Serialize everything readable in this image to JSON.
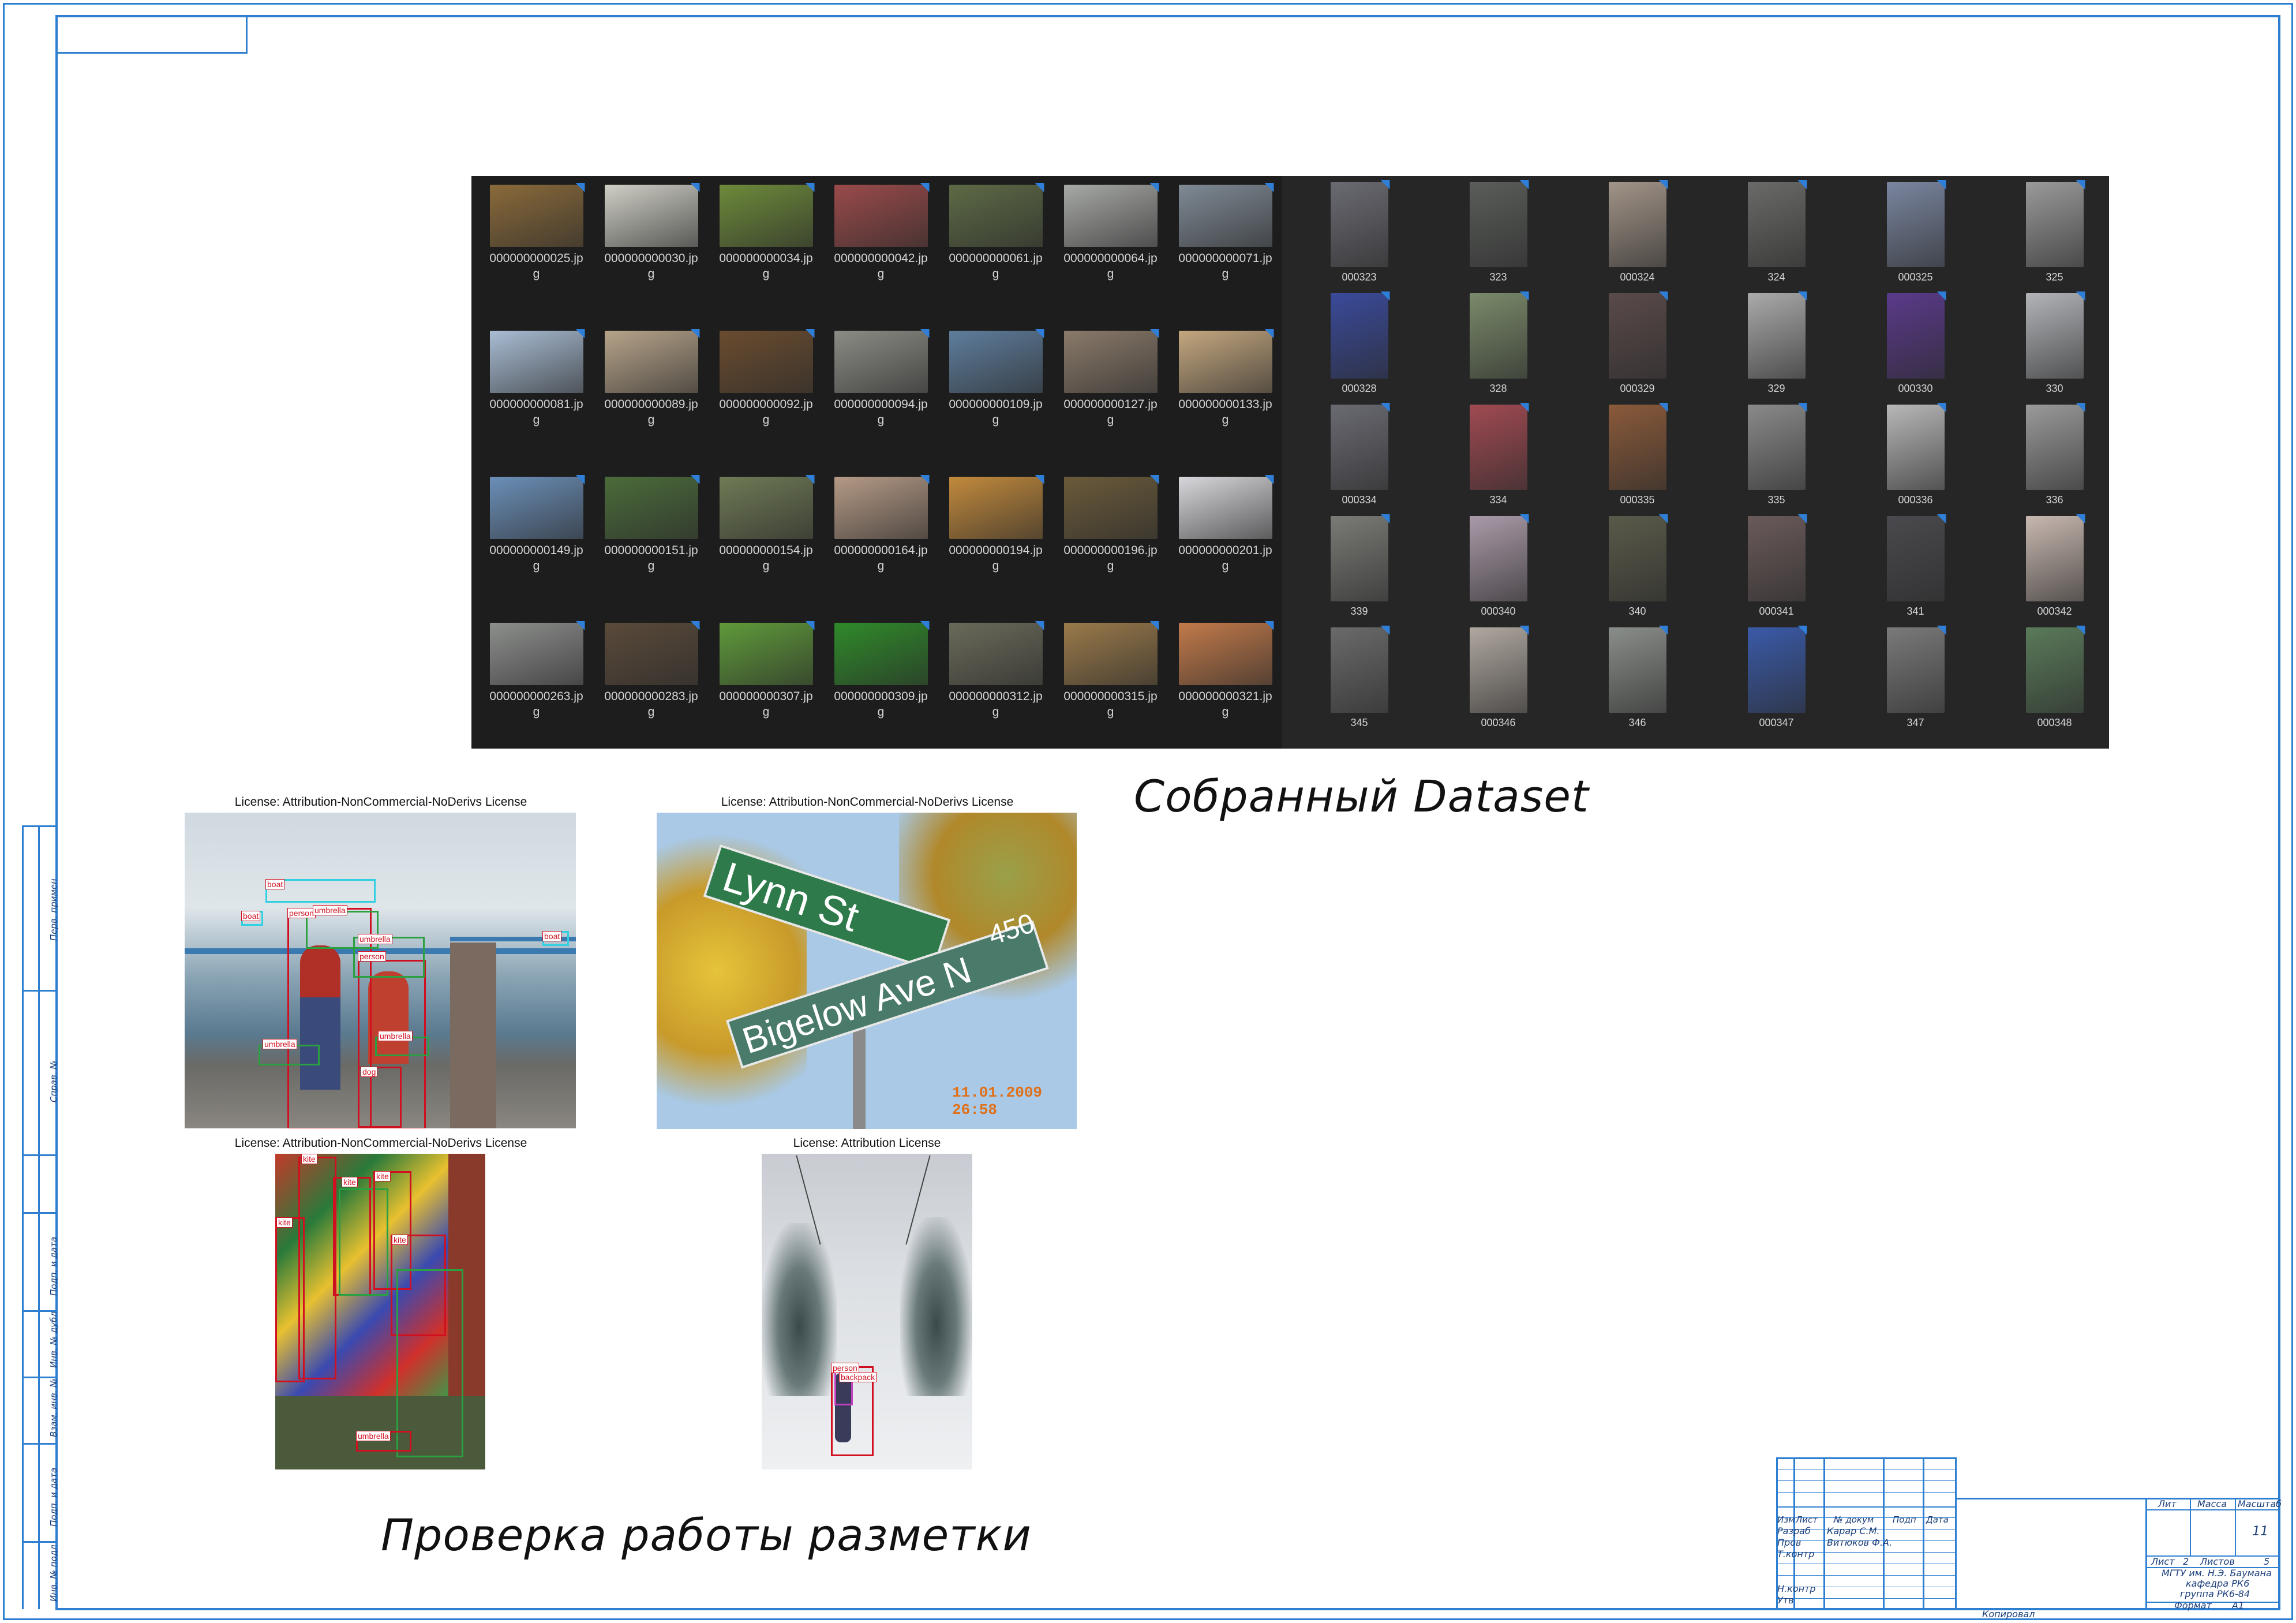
{
  "dataset_coco": [
    {
      "name": "000000000025.jpg",
      "c": "#8a6a3a"
    },
    {
      "name": "000000000030.jpg",
      "c": "#cfcfc6"
    },
    {
      "name": "000000000034.jpg",
      "c": "#6d8a3a"
    },
    {
      "name": "000000000042.jpg",
      "c": "#9a4a4a"
    },
    {
      "name": "000000000061.jpg",
      "c": "#5d6a45"
    },
    {
      "name": "000000000064.jpg",
      "c": "#a7a9a6"
    },
    {
      "name": "000000000071.jpg",
      "c": "#7f8a95"
    },
    {
      "name": "000000000081.jpg",
      "c": "#a9bdd4"
    },
    {
      "name": "000000000089.jpg",
      "c": "#b7a48a"
    },
    {
      "name": "000000000092.jpg",
      "c": "#6a4c2f"
    },
    {
      "name": "000000000094.jpg",
      "c": "#8c8c86"
    },
    {
      "name": "000000000109.jpg",
      "c": "#5e7d9c"
    },
    {
      "name": "000000000127.jpg",
      "c": "#8a7a6a"
    },
    {
      "name": "000000000133.jpg",
      "c": "#c4a77f"
    },
    {
      "name": "000000000149.jpg",
      "c": "#6b8fb8"
    },
    {
      "name": "000000000151.jpg",
      "c": "#4b6b3a"
    },
    {
      "name": "000000000154.jpg",
      "c": "#6f7a55"
    },
    {
      "name": "000000000164.jpg",
      "c": "#b59a86"
    },
    {
      "name": "000000000194.jpg",
      "c": "#c28a3c"
    },
    {
      "name": "000000000196.jpg",
      "c": "#6a5a3a"
    },
    {
      "name": "000000000201.jpg",
      "c": "#d8d8dc"
    },
    {
      "name": "000000000263.jpg",
      "c": "#8d8f8d"
    },
    {
      "name": "000000000283.jpg",
      "c": "#5a4a3a"
    },
    {
      "name": "000000000307.jpg",
      "c": "#5f9a3a"
    },
    {
      "name": "000000000309.jpg",
      "c": "#2f8a2a"
    },
    {
      "name": "000000000312.jpg",
      "c": "#6a6a5a"
    },
    {
      "name": "000000000315.jpg",
      "c": "#9a7a4a"
    },
    {
      "name": "000000000321.jpg",
      "c": "#c27a4a"
    }
  ],
  "dataset_persons": [
    {
      "name": "000323",
      "c": "#6a6a72"
    },
    {
      "name": "323",
      "c": "#5a5d5a"
    },
    {
      "name": "000324",
      "c": "#a29488"
    },
    {
      "name": "324",
      "c": "#6a6a68"
    },
    {
      "name": "000325",
      "c": "#7a86a0"
    },
    {
      "name": "325",
      "c": "#9a9a9a"
    },
    {
      "name": "000328",
      "c": "#3a4a9a"
    },
    {
      "name": "328",
      "c": "#7a8a6a"
    },
    {
      "name": "000329",
      "c": "#5a4a4a"
    },
    {
      "name": "329",
      "c": "#aaaaaa"
    },
    {
      "name": "000330",
      "c": "#5a3a8a"
    },
    {
      "name": "330",
      "c": "#b2b4b8"
    },
    {
      "name": "000334",
      "c": "#6a6a72"
    },
    {
      "name": "334",
      "c": "#a04a52"
    },
    {
      "name": "000335",
      "c": "#8a5a3a"
    },
    {
      "name": "335",
      "c": "#8a8a8a"
    },
    {
      "name": "000336",
      "c": "#b8b8b8"
    },
    {
      "name": "336",
      "c": "#9a9a9a"
    },
    {
      "name": "339",
      "c": "#7a7a76"
    },
    {
      "name": "000340",
      "c": "#aa9aa8"
    },
    {
      "name": "340",
      "c": "#5a5a4a"
    },
    {
      "name": "000341",
      "c": "#6a5a5a"
    },
    {
      "name": "341",
      "c": "#4a4a4e"
    },
    {
      "name": "000342",
      "c": "#c8b8b0"
    },
    {
      "name": "345",
      "c": "#6a6a6a"
    },
    {
      "name": "000346",
      "c": "#b0a8a0"
    },
    {
      "name": "346",
      "c": "#8a8e8a"
    },
    {
      "name": "000347",
      "c": "#3a5aa8"
    },
    {
      "name": "347",
      "c": "#7a7a7a"
    },
    {
      "name": "000348",
      "c": "#5a7a5a"
    }
  ],
  "caption_dataset": "Собранный Dataset",
  "caption_markup": "Проверка работы разметки",
  "samples": [
    {
      "license": "License: Attribution-NonCommercial-NoDerivs License"
    },
    {
      "license": "License: Attribution-NonCommercial-NoDerivs License",
      "sign1": "Lynn St",
      "sign2": "Bigelow Ave N",
      "num": "450",
      "stamp": "11.01.2009 26:58"
    },
    {
      "license": "License: Attribution-NonCommercial-NoDerivs License"
    },
    {
      "license": "License: Attribution License"
    }
  ],
  "labels": {
    "boat": "boat",
    "person": "person",
    "umbrella": "umbrella",
    "dog": "dog",
    "kite": "kite",
    "backpack": "backpack"
  },
  "stamp": {
    "izm": "Изм",
    "list": "Лист",
    "ndoc": "№ докум",
    "podp": "Подп",
    "data": "Дата",
    "razrab": "Разраб",
    "razrab_name": "Карар С.М.",
    "prov": "Пров",
    "prov_name": "Витюков Ф.А.",
    "tkontr": "Т.контр",
    "nkontr": "Н.контр",
    "utv": "Утв",
    "lit": "Лит",
    "massa": "Масса",
    "masshtab": "Масштаб",
    "scale": "11",
    "list2": "Лист",
    "list_num": "2",
    "listov": "Листов",
    "listov_num": "5",
    "org1": "МГТУ им. Н.Э. Баумана",
    "org2": "кафедра РК6",
    "org3": "группа РК6-84",
    "format": "Формат",
    "format_val": "А1",
    "kopiroval": "Копировал"
  },
  "side": [
    "Перв. примен",
    "Справ. №",
    "Подп. и дата",
    "Инв. № дубл",
    "Взам. инв. №",
    "Подп. и дата",
    "Инв. № подл"
  ]
}
